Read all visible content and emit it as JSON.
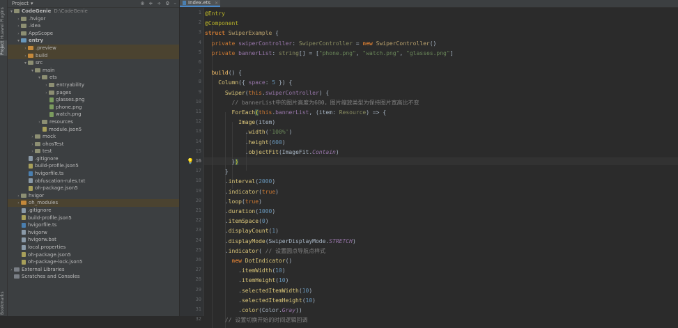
{
  "side_strip": {
    "tab1": "Huawei Plugins",
    "tab2": "Project",
    "tab3": "Bookmarks"
  },
  "project_panel": {
    "title": "Project",
    "tools": [
      "⊕",
      "≑",
      "÷",
      "⚙",
      "–"
    ],
    "tree": [
      {
        "indent": 0,
        "arrow": "▾",
        "icon": "folder",
        "label": "CodeGenie",
        "bold": true,
        "muted": "D:\\CodeGenie"
      },
      {
        "indent": 1,
        "arrow": "›",
        "icon": "folder",
        "label": ".hvigor"
      },
      {
        "indent": 1,
        "arrow": "›",
        "icon": "folder",
        "label": ".idea"
      },
      {
        "indent": 1,
        "arrow": "›",
        "icon": "folder",
        "label": "AppScope"
      },
      {
        "indent": 1,
        "arrow": "▾",
        "icon": "folder blue",
        "label": "entry",
        "bold": true
      },
      {
        "indent": 2,
        "arrow": "›",
        "icon": "folder orange",
        "label": ".preview",
        "hl": true
      },
      {
        "indent": 2,
        "arrow": "›",
        "icon": "folder orange",
        "label": "build",
        "hl": true
      },
      {
        "indent": 2,
        "arrow": "▾",
        "icon": "folder",
        "label": "src"
      },
      {
        "indent": 3,
        "arrow": "▾",
        "icon": "folder",
        "label": "main"
      },
      {
        "indent": 4,
        "arrow": "▾",
        "icon": "folder",
        "label": "ets"
      },
      {
        "indent": 5,
        "arrow": "›",
        "icon": "folder",
        "label": "entryability"
      },
      {
        "indent": 5,
        "arrow": "›",
        "icon": "folder",
        "label": "pages"
      },
      {
        "indent": 5,
        "arrow": "",
        "icon": "file img",
        "label": "glasses.png"
      },
      {
        "indent": 5,
        "arrow": "",
        "icon": "file img",
        "label": "phone.png"
      },
      {
        "indent": 5,
        "arrow": "",
        "icon": "file img",
        "label": "watch.png"
      },
      {
        "indent": 4,
        "arrow": "›",
        "icon": "folder",
        "label": "resources"
      },
      {
        "indent": 4,
        "arrow": "",
        "icon": "file json",
        "label": "module.json5"
      },
      {
        "indent": 3,
        "arrow": "›",
        "icon": "folder",
        "label": "mock"
      },
      {
        "indent": 3,
        "arrow": "›",
        "icon": "folder",
        "label": "ohosTest"
      },
      {
        "indent": 3,
        "arrow": "›",
        "icon": "folder",
        "label": "test"
      },
      {
        "indent": 2,
        "arrow": "",
        "icon": "file",
        "label": ".gitignore"
      },
      {
        "indent": 2,
        "arrow": "",
        "icon": "file json",
        "label": "build-profile.json5"
      },
      {
        "indent": 2,
        "arrow": "",
        "icon": "file ts",
        "label": "hvigorfile.ts"
      },
      {
        "indent": 2,
        "arrow": "",
        "icon": "file",
        "label": "obfuscation-rules.txt"
      },
      {
        "indent": 2,
        "arrow": "",
        "icon": "file json",
        "label": "oh-package.json5"
      },
      {
        "indent": 1,
        "arrow": "›",
        "icon": "folder",
        "label": "hvigor"
      },
      {
        "indent": 1,
        "arrow": "›",
        "icon": "folder orange",
        "label": "oh_modules",
        "hl": true
      },
      {
        "indent": 1,
        "arrow": "",
        "icon": "file",
        "label": ".gitignore"
      },
      {
        "indent": 1,
        "arrow": "",
        "icon": "file json",
        "label": "build-profile.json5"
      },
      {
        "indent": 1,
        "arrow": "",
        "icon": "file ts",
        "label": "hvigorfile.ts"
      },
      {
        "indent": 1,
        "arrow": "",
        "icon": "file",
        "label": "hvigorw"
      },
      {
        "indent": 1,
        "arrow": "",
        "icon": "file",
        "label": "hvigorw.bat"
      },
      {
        "indent": 1,
        "arrow": "",
        "icon": "file",
        "label": "local.properties"
      },
      {
        "indent": 1,
        "arrow": "",
        "icon": "file json",
        "label": "oh-package.json5"
      },
      {
        "indent": 1,
        "arrow": "",
        "icon": "file json",
        "label": "oh-package-lock.json5"
      },
      {
        "indent": 0,
        "arrow": "›",
        "icon": "lib",
        "label": "External Libraries"
      },
      {
        "indent": 0,
        "arrow": "",
        "icon": "lib",
        "label": "Scratches and Consoles"
      }
    ]
  },
  "editor": {
    "tab_label": "Index.ets",
    "tab_close": "×",
    "current_line": 16,
    "line_numbers": [
      "1",
      "2",
      "3",
      "4",
      "5",
      "6",
      "7",
      "8",
      "9",
      "10",
      "11",
      "12",
      "13",
      "14",
      "15",
      "16",
      "17",
      "18",
      "19",
      "20",
      "21",
      "22",
      "23",
      "24",
      "25",
      "26",
      "27",
      "28",
      "29",
      "30",
      "31",
      "32"
    ],
    "lines": [
      [
        [
          "an",
          "@Entry"
        ]
      ],
      [
        [
          "an",
          "@Component"
        ]
      ],
      [
        [
          "kw",
          "struct "
        ],
        [
          "cls",
          "SwiperExample "
        ],
        [
          "br",
          "{"
        ]
      ],
      [
        [
          "kwn",
          "  private "
        ],
        [
          "pr",
          "swiperController"
        ],
        [
          "br",
          ": "
        ],
        [
          "tp",
          "SwiperController"
        ],
        [
          "br",
          " = "
        ],
        [
          "kw",
          "new "
        ],
        [
          "cls",
          "SwiperController"
        ],
        [
          "br",
          "()"
        ]
      ],
      [
        [
          "kwn",
          "  private "
        ],
        [
          "pr",
          "bannerList"
        ],
        [
          "br",
          ": "
        ],
        [
          "tp",
          "string"
        ],
        [
          "br",
          "[] = ["
        ],
        [
          "st",
          "\"phone.png\""
        ],
        [
          "br",
          ", "
        ],
        [
          "st",
          "\"watch.png\""
        ],
        [
          "br",
          ", "
        ],
        [
          "st",
          "\"glasses.png\""
        ],
        [
          "br",
          "]"
        ]
      ],
      [
        [
          "br",
          ""
        ]
      ],
      [
        [
          "fn",
          "  build"
        ],
        [
          "br",
          "() {"
        ]
      ],
      [
        [
          "mt",
          "    Column"
        ],
        [
          "br",
          "({ "
        ],
        [
          "pr",
          "space"
        ],
        [
          "br",
          ": "
        ],
        [
          "nu",
          "5"
        ],
        [
          "br",
          " }) {"
        ]
      ],
      [
        [
          "mt",
          "      Swiper"
        ],
        [
          "br",
          "("
        ],
        [
          "kwn",
          "this"
        ],
        [
          "br",
          "."
        ],
        [
          "pr",
          "swiperController"
        ],
        [
          "br",
          ") {"
        ]
      ],
      [
        [
          "cm",
          "        // bannerList中的图片高度为680，图片缩放类型为保持图片宽高比不变"
        ]
      ],
      [
        [
          "mt",
          "        ForEach"
        ],
        [
          "brm",
          "("
        ],
        [
          "kwn",
          "this"
        ],
        [
          "br",
          "."
        ],
        [
          "pr",
          "bannerList"
        ],
        [
          "br",
          ", ("
        ],
        [
          "br",
          "item: "
        ],
        [
          "tp",
          "Resource"
        ],
        [
          "br",
          ") => {"
        ]
      ],
      [
        [
          "mt",
          "          Image"
        ],
        [
          "br",
          "(item)"
        ]
      ],
      [
        [
          "br",
          "            ."
        ],
        [
          "mt",
          "width"
        ],
        [
          "br",
          "("
        ],
        [
          "st",
          "'100%'"
        ],
        [
          "br",
          ")"
        ]
      ],
      [
        [
          "br",
          "            ."
        ],
        [
          "mt",
          "height"
        ],
        [
          "br",
          "("
        ],
        [
          "nu",
          "600"
        ],
        [
          "br",
          ")"
        ]
      ],
      [
        [
          "br",
          "            ."
        ],
        [
          "mt",
          "objectFit"
        ],
        [
          "br",
          "(ImageFit."
        ],
        [
          "en",
          "Contain"
        ],
        [
          "br",
          ")"
        ]
      ],
      [
        [
          "br",
          "        }"
        ],
        [
          "brm",
          ")"
        ]
      ],
      [
        [
          "br",
          "      }"
        ]
      ],
      [
        [
          "br",
          "      ."
        ],
        [
          "mt",
          "interval"
        ],
        [
          "br",
          "("
        ],
        [
          "nu",
          "2000"
        ],
        [
          "br",
          ")"
        ]
      ],
      [
        [
          "br",
          "      ."
        ],
        [
          "mt",
          "indicator"
        ],
        [
          "br",
          "("
        ],
        [
          "kwn",
          "true"
        ],
        [
          "br",
          ")"
        ]
      ],
      [
        [
          "br",
          "      ."
        ],
        [
          "mt",
          "loop"
        ],
        [
          "br",
          "("
        ],
        [
          "kwn",
          "true"
        ],
        [
          "br",
          ")"
        ]
      ],
      [
        [
          "br",
          "      ."
        ],
        [
          "mt",
          "duration"
        ],
        [
          "br",
          "("
        ],
        [
          "nu",
          "1000"
        ],
        [
          "br",
          ")"
        ]
      ],
      [
        [
          "br",
          "      ."
        ],
        [
          "mt",
          "itemSpace"
        ],
        [
          "br",
          "("
        ],
        [
          "nu",
          "0"
        ],
        [
          "br",
          ")"
        ]
      ],
      [
        [
          "br",
          "      ."
        ],
        [
          "mt",
          "displayCount"
        ],
        [
          "br",
          "("
        ],
        [
          "nu",
          "1"
        ],
        [
          "br",
          ")"
        ]
      ],
      [
        [
          "br",
          "      ."
        ],
        [
          "mt",
          "displayMode"
        ],
        [
          "br",
          "(SwiperDisplayMode."
        ],
        [
          "en",
          "STRETCH"
        ],
        [
          "br",
          ")"
        ]
      ],
      [
        [
          "br",
          "      ."
        ],
        [
          "mt",
          "indicator"
        ],
        [
          "br",
          "( "
        ],
        [
          "cm",
          "// 设置圆点导航点样式"
        ]
      ],
      [
        [
          "kw",
          "        new "
        ],
        [
          "mt",
          "DotIndicator"
        ],
        [
          "br",
          "()"
        ]
      ],
      [
        [
          "br",
          "          ."
        ],
        [
          "mt",
          "itemWidth"
        ],
        [
          "br",
          "("
        ],
        [
          "nu",
          "10"
        ],
        [
          "br",
          ")"
        ]
      ],
      [
        [
          "br",
          "          ."
        ],
        [
          "mt",
          "itemHeight"
        ],
        [
          "br",
          "("
        ],
        [
          "nu",
          "10"
        ],
        [
          "br",
          ")"
        ]
      ],
      [
        [
          "br",
          "          ."
        ],
        [
          "mt",
          "selectedItemWidth"
        ],
        [
          "br",
          "("
        ],
        [
          "nu",
          "10"
        ],
        [
          "br",
          ")"
        ]
      ],
      [
        [
          "br",
          "          ."
        ],
        [
          "mt",
          "selectedItemHeight"
        ],
        [
          "br",
          "("
        ],
        [
          "nu",
          "10"
        ],
        [
          "br",
          ")"
        ]
      ],
      [
        [
          "br",
          "          ."
        ],
        [
          "mt",
          "color"
        ],
        [
          "br",
          "(Color."
        ],
        [
          "en",
          "Gray"
        ],
        [
          "br",
          "))"
        ]
      ],
      [
        [
          "cm",
          "      // 设置切换开始的时间逻辑回调"
        ]
      ]
    ]
  }
}
